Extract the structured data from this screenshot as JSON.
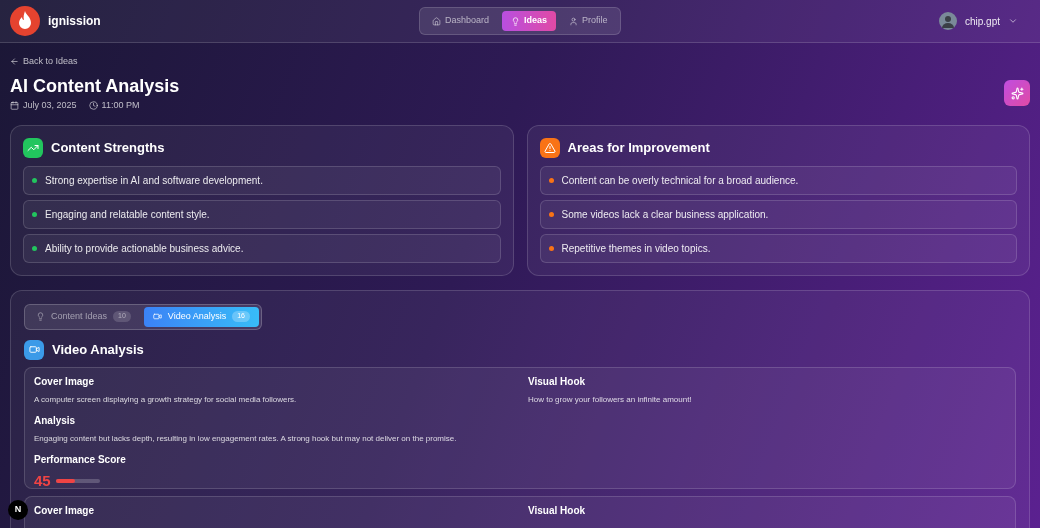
{
  "brand": {
    "name": "ignission"
  },
  "nav": [
    {
      "label": "Dashboard",
      "selected": false
    },
    {
      "label": "Ideas",
      "selected": true
    },
    {
      "label": "Profile",
      "selected": false
    }
  ],
  "user": {
    "name": "chip.gpt"
  },
  "back_link": "Back to Ideas",
  "title": "AI Content Analysis",
  "date": "July 03, 2025",
  "time": "11:00 PM",
  "panels": [
    {
      "kind": "strengths",
      "title": "Content Strengths",
      "color": "#22c55e",
      "items": [
        "Strong expertise in AI and software development.",
        "Engaging and relatable content style.",
        "Ability to provide actionable business advice."
      ]
    },
    {
      "kind": "improvement",
      "title": "Areas for Improvement",
      "color": "#f97316",
      "items": [
        "Content can be overly technical for a broad audience.",
        "Some videos lack a clear business application.",
        "Repetitive themes in video topics."
      ]
    }
  ],
  "tabs": [
    {
      "label": "Content Ideas",
      "count": "10",
      "selected": false
    },
    {
      "label": "Video Analysis",
      "count": "16",
      "selected": true
    }
  ],
  "section_title": "Video Analysis",
  "videos": [
    {
      "cover_label": "Cover Image",
      "cover": "A computer screen displaying a growth strategy for social media followers.",
      "hook_label": "Visual Hook",
      "hook": "How to grow your followers an infinite amount!",
      "analysis_label": "Analysis",
      "analysis": "Engaging content but lacks depth, resulting in low engagement rates. A strong hook but may not deliver on the promise.",
      "score_label": "Performance Score",
      "score": "45",
      "level": 0.45
    },
    {
      "cover_label": "Cover Image",
      "hook_label": "Visual Hook"
    }
  ],
  "dev_badge": "N"
}
